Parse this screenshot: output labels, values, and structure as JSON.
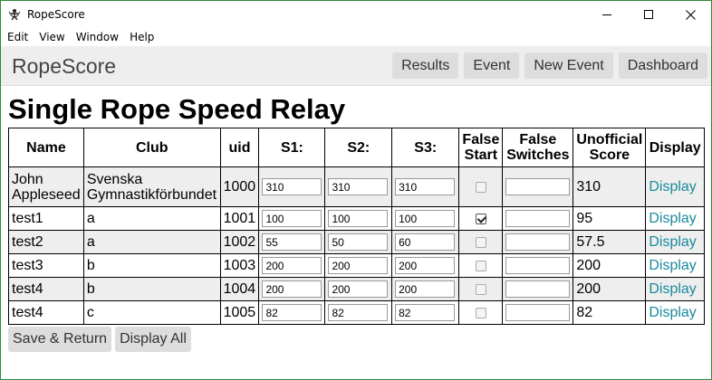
{
  "window": {
    "title": "RopeScore"
  },
  "menu": {
    "items": [
      "Edit",
      "View",
      "Window",
      "Help"
    ]
  },
  "navbar": {
    "brand": "RopeScore",
    "buttons": [
      "Results",
      "Event",
      "New Event",
      "Dashboard"
    ]
  },
  "page": {
    "title": "Single Rope Speed Relay"
  },
  "table": {
    "headers": {
      "name": "Name",
      "club": "Club",
      "uid": "uid",
      "s1": "S1:",
      "s2": "S2:",
      "s3": "S3:",
      "false_start_1": "False",
      "false_start_2": "Start",
      "false_switches_1": "False",
      "false_switches_2": "Switches",
      "unofficial_1": "Unofficial",
      "unofficial_2": "Score",
      "display": "Display"
    },
    "rows": [
      {
        "name_1": "John",
        "name_2": "Appleseed",
        "club_1": "Svenska",
        "club_2": "Gymnastikförbundet",
        "uid": "1000",
        "s1": "310",
        "s2": "310",
        "s3": "310",
        "false_start": false,
        "false_switches": "",
        "score": "310",
        "display": "Display"
      },
      {
        "name": "test1",
        "club": "a",
        "uid": "1001",
        "s1": "100",
        "s2": "100",
        "s3": "100",
        "false_start": true,
        "false_switches": "",
        "score": "95",
        "display": "Display"
      },
      {
        "name": "test2",
        "club": "a",
        "uid": "1002",
        "s1": "55",
        "s2": "50",
        "s3": "60",
        "false_start": false,
        "false_switches": "",
        "score": "57.5",
        "display": "Display"
      },
      {
        "name": "test3",
        "club": "b",
        "uid": "1003",
        "s1": "200",
        "s2": "200",
        "s3": "200",
        "false_start": false,
        "false_switches": "",
        "score": "200",
        "display": "Display"
      },
      {
        "name": "test4",
        "club": "b",
        "uid": "1004",
        "s1": "200",
        "s2": "200",
        "s3": "200",
        "false_start": false,
        "false_switches": "",
        "score": "200",
        "display": "Display"
      },
      {
        "name": "test4",
        "club": "c",
        "uid": "1005",
        "s1": "82",
        "s2": "82",
        "s3": "82",
        "false_start": false,
        "false_switches": "",
        "score": "82",
        "display": "Display"
      }
    ]
  },
  "actions": {
    "save_return": "Save & Return",
    "display_all": "Display All"
  },
  "colors": {
    "link": "#1a8a9e",
    "row_shade": "#eeeeee",
    "window_border": "#2b8a3e"
  }
}
